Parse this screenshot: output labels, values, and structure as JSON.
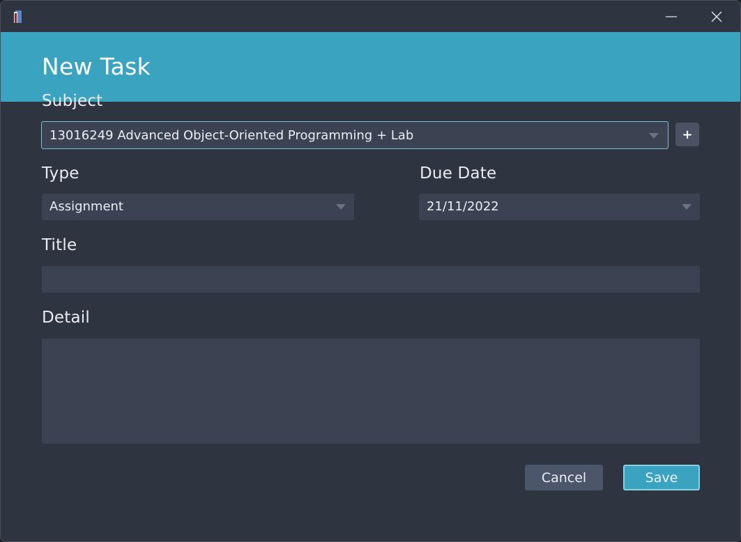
{
  "window": {
    "app_icon": "book-icon",
    "minimize_icon": "minimize-icon",
    "close_icon": "close-icon"
  },
  "header": {
    "title": "New Task",
    "background": "#3aa3c0"
  },
  "form": {
    "subject": {
      "label": "Subject",
      "value": "13016249 Advanced Object-Oriented Programming + Lab",
      "add_label": "+"
    },
    "type": {
      "label": "Type",
      "value": "Assignment"
    },
    "due_date": {
      "label": "Due Date",
      "value": "21/11/2022"
    },
    "title": {
      "label": "Title",
      "value": ""
    },
    "detail": {
      "label": "Detail",
      "value": ""
    }
  },
  "actions": {
    "cancel_label": "Cancel",
    "save_label": "Save"
  },
  "colors": {
    "background": "#2e3440",
    "field": "#3b4252",
    "accent": "#3aa3c0",
    "cancel": "#4c566a"
  }
}
